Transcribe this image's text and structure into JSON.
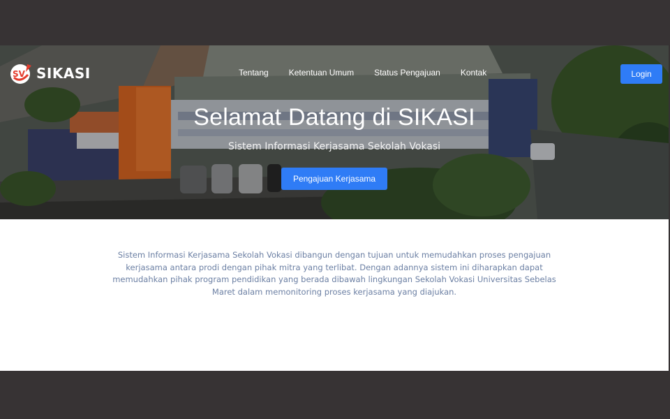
{
  "brand": {
    "logo_text": "SV",
    "name": "SIKASI"
  },
  "nav": {
    "links": [
      {
        "label": "Tentang"
      },
      {
        "label": "Ketentuan Umum"
      },
      {
        "label": "Status Pengajuan"
      },
      {
        "label": "Kontak"
      }
    ],
    "login_label": "Login"
  },
  "hero": {
    "title": "Selamat Datang di SIKASI",
    "subtitle": "Sistem Informasi Kerjasama Sekolah Vokasi",
    "cta_label": "Pengajuan Kerjasama",
    "image": "aerial-campus-photo"
  },
  "description": "Sistem Informasi Kerjasama Sekolah Vokasi dibangun dengan tujuan untuk memudahkan proses pengajuan kerjasama antara prodi dengan pihak mitra yang terlibat. Dengan adannya sistem ini diharapkan dapat memudahkan pihak program pendidikan yang berada dibawah lingkungan Sekolah Vokasi Universitas Sebelas Maret dalam memonitoring proses kerjasama yang diajukan.",
  "colors": {
    "accent": "#2f7cf6",
    "description_text": "#6b7fa3",
    "backdrop": "#373334"
  }
}
